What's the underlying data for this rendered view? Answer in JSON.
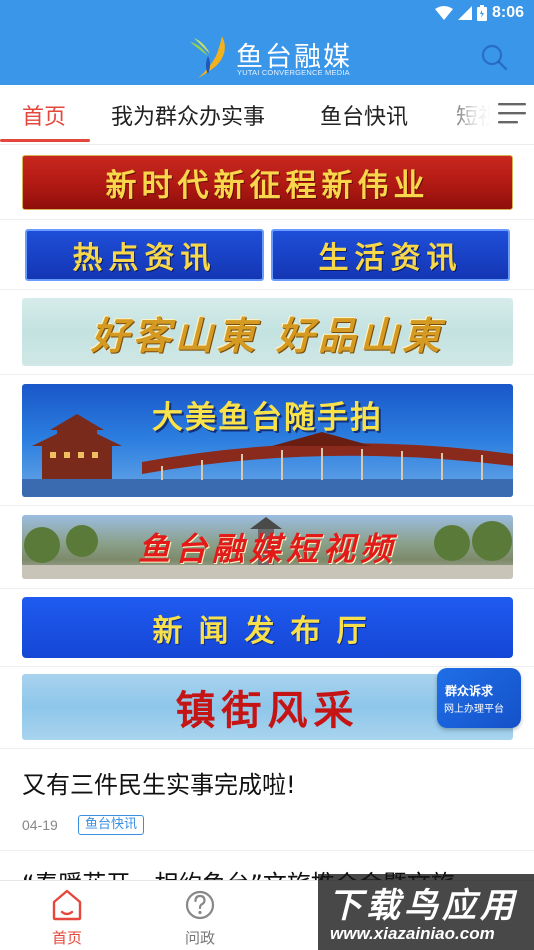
{
  "status_bar": {
    "time": "8:06"
  },
  "header": {
    "app_name": "鱼台融媒",
    "app_subtitle": "YUTAI CONVERGENCE MEDIA"
  },
  "tabs": [
    {
      "label": "首页",
      "active": true
    },
    {
      "label": "我为群众办实事",
      "active": false
    },
    {
      "label": "鱼台快讯",
      "active": false
    },
    {
      "label": "短视",
      "active": false
    }
  ],
  "banners": {
    "new_era": "新时代新征程新伟业",
    "hot_news": "热点资讯",
    "life_news": "生活资讯",
    "shandong": "好客山東 好品山東",
    "yutai_photo": "大美鱼台随手拍",
    "short_video": "鱼台融媒短视频",
    "press_hall": "新闻发布厅",
    "town_style": "镇街风采"
  },
  "float_badge": {
    "line1": "群众诉求",
    "line2": "网上办理平台"
  },
  "news": [
    {
      "title": "又有三件民生实事完成啦!",
      "date": "04-19",
      "tag": "鱼台快讯"
    },
    {
      "title": "“春暖花开，相约鱼台”文旅推介会暨文旅",
      "date": "",
      "tag": ""
    }
  ],
  "bottom_nav": [
    {
      "label": "首页",
      "icon": "home-icon",
      "active": true
    },
    {
      "label": "问政",
      "icon": "question-icon",
      "active": false
    }
  ],
  "watermark": {
    "title": "下载鸟应用",
    "url": "www.xiazainiao.com"
  },
  "colors": {
    "header_blue": "#3a96e8",
    "accent_red": "#e5473c",
    "tag_blue": "#3a8fe0"
  }
}
